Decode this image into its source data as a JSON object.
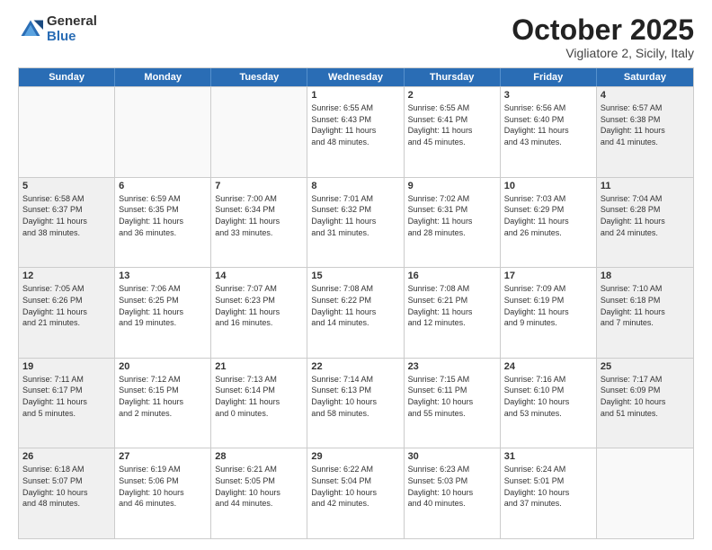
{
  "logo": {
    "general": "General",
    "blue": "Blue"
  },
  "title": {
    "month": "October 2025",
    "location": "Vigliatore 2, Sicily, Italy"
  },
  "days": [
    "Sunday",
    "Monday",
    "Tuesday",
    "Wednesday",
    "Thursday",
    "Friday",
    "Saturday"
  ],
  "rows": [
    [
      {
        "day": "",
        "text": "",
        "empty": true
      },
      {
        "day": "",
        "text": "",
        "empty": true
      },
      {
        "day": "",
        "text": "",
        "empty": true
      },
      {
        "day": "1",
        "text": "Sunrise: 6:55 AM\nSunset: 6:43 PM\nDaylight: 11 hours\nand 48 minutes.",
        "empty": false
      },
      {
        "day": "2",
        "text": "Sunrise: 6:55 AM\nSunset: 6:41 PM\nDaylight: 11 hours\nand 45 minutes.",
        "empty": false
      },
      {
        "day": "3",
        "text": "Sunrise: 6:56 AM\nSunset: 6:40 PM\nDaylight: 11 hours\nand 43 minutes.",
        "empty": false
      },
      {
        "day": "4",
        "text": "Sunrise: 6:57 AM\nSunset: 6:38 PM\nDaylight: 11 hours\nand 41 minutes.",
        "empty": false,
        "shaded": true
      }
    ],
    [
      {
        "day": "5",
        "text": "Sunrise: 6:58 AM\nSunset: 6:37 PM\nDaylight: 11 hours\nand 38 minutes.",
        "empty": false,
        "shaded": true
      },
      {
        "day": "6",
        "text": "Sunrise: 6:59 AM\nSunset: 6:35 PM\nDaylight: 11 hours\nand 36 minutes.",
        "empty": false
      },
      {
        "day": "7",
        "text": "Sunrise: 7:00 AM\nSunset: 6:34 PM\nDaylight: 11 hours\nand 33 minutes.",
        "empty": false
      },
      {
        "day": "8",
        "text": "Sunrise: 7:01 AM\nSunset: 6:32 PM\nDaylight: 11 hours\nand 31 minutes.",
        "empty": false
      },
      {
        "day": "9",
        "text": "Sunrise: 7:02 AM\nSunset: 6:31 PM\nDaylight: 11 hours\nand 28 minutes.",
        "empty": false
      },
      {
        "day": "10",
        "text": "Sunrise: 7:03 AM\nSunset: 6:29 PM\nDaylight: 11 hours\nand 26 minutes.",
        "empty": false
      },
      {
        "day": "11",
        "text": "Sunrise: 7:04 AM\nSunset: 6:28 PM\nDaylight: 11 hours\nand 24 minutes.",
        "empty": false,
        "shaded": true
      }
    ],
    [
      {
        "day": "12",
        "text": "Sunrise: 7:05 AM\nSunset: 6:26 PM\nDaylight: 11 hours\nand 21 minutes.",
        "empty": false,
        "shaded": true
      },
      {
        "day": "13",
        "text": "Sunrise: 7:06 AM\nSunset: 6:25 PM\nDaylight: 11 hours\nand 19 minutes.",
        "empty": false
      },
      {
        "day": "14",
        "text": "Sunrise: 7:07 AM\nSunset: 6:23 PM\nDaylight: 11 hours\nand 16 minutes.",
        "empty": false
      },
      {
        "day": "15",
        "text": "Sunrise: 7:08 AM\nSunset: 6:22 PM\nDaylight: 11 hours\nand 14 minutes.",
        "empty": false
      },
      {
        "day": "16",
        "text": "Sunrise: 7:08 AM\nSunset: 6:21 PM\nDaylight: 11 hours\nand 12 minutes.",
        "empty": false
      },
      {
        "day": "17",
        "text": "Sunrise: 7:09 AM\nSunset: 6:19 PM\nDaylight: 11 hours\nand 9 minutes.",
        "empty": false
      },
      {
        "day": "18",
        "text": "Sunrise: 7:10 AM\nSunset: 6:18 PM\nDaylight: 11 hours\nand 7 minutes.",
        "empty": false,
        "shaded": true
      }
    ],
    [
      {
        "day": "19",
        "text": "Sunrise: 7:11 AM\nSunset: 6:17 PM\nDaylight: 11 hours\nand 5 minutes.",
        "empty": false,
        "shaded": true
      },
      {
        "day": "20",
        "text": "Sunrise: 7:12 AM\nSunset: 6:15 PM\nDaylight: 11 hours\nand 2 minutes.",
        "empty": false
      },
      {
        "day": "21",
        "text": "Sunrise: 7:13 AM\nSunset: 6:14 PM\nDaylight: 11 hours\nand 0 minutes.",
        "empty": false
      },
      {
        "day": "22",
        "text": "Sunrise: 7:14 AM\nSunset: 6:13 PM\nDaylight: 10 hours\nand 58 minutes.",
        "empty": false
      },
      {
        "day": "23",
        "text": "Sunrise: 7:15 AM\nSunset: 6:11 PM\nDaylight: 10 hours\nand 55 minutes.",
        "empty": false
      },
      {
        "day": "24",
        "text": "Sunrise: 7:16 AM\nSunset: 6:10 PM\nDaylight: 10 hours\nand 53 minutes.",
        "empty": false
      },
      {
        "day": "25",
        "text": "Sunrise: 7:17 AM\nSunset: 6:09 PM\nDaylight: 10 hours\nand 51 minutes.",
        "empty": false,
        "shaded": true
      }
    ],
    [
      {
        "day": "26",
        "text": "Sunrise: 6:18 AM\nSunset: 5:07 PM\nDaylight: 10 hours\nand 48 minutes.",
        "empty": false,
        "shaded": true
      },
      {
        "day": "27",
        "text": "Sunrise: 6:19 AM\nSunset: 5:06 PM\nDaylight: 10 hours\nand 46 minutes.",
        "empty": false
      },
      {
        "day": "28",
        "text": "Sunrise: 6:21 AM\nSunset: 5:05 PM\nDaylight: 10 hours\nand 44 minutes.",
        "empty": false
      },
      {
        "day": "29",
        "text": "Sunrise: 6:22 AM\nSunset: 5:04 PM\nDaylight: 10 hours\nand 42 minutes.",
        "empty": false
      },
      {
        "day": "30",
        "text": "Sunrise: 6:23 AM\nSunset: 5:03 PM\nDaylight: 10 hours\nand 40 minutes.",
        "empty": false
      },
      {
        "day": "31",
        "text": "Sunrise: 6:24 AM\nSunset: 5:01 PM\nDaylight: 10 hours\nand 37 minutes.",
        "empty": false
      },
      {
        "day": "",
        "text": "",
        "empty": true,
        "shaded": true
      }
    ]
  ]
}
